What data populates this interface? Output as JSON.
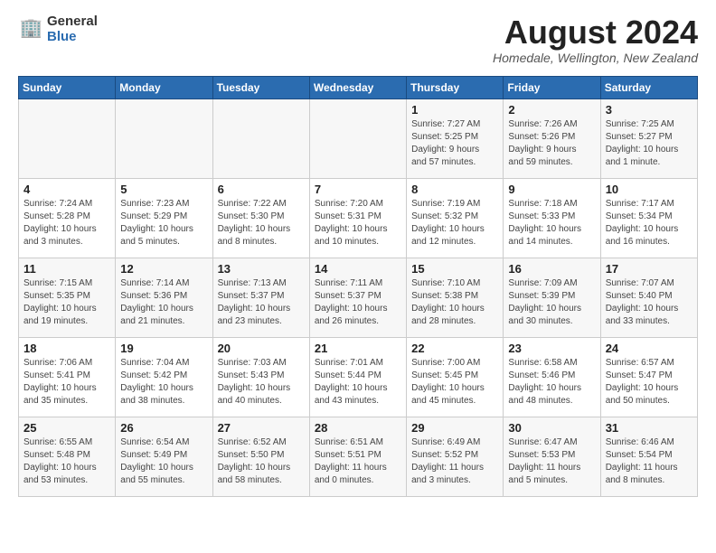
{
  "header": {
    "logo_general": "General",
    "logo_blue": "Blue",
    "month_title": "August 2024",
    "location": "Homedale, Wellington, New Zealand"
  },
  "calendar": {
    "days_of_week": [
      "Sunday",
      "Monday",
      "Tuesday",
      "Wednesday",
      "Thursday",
      "Friday",
      "Saturday"
    ],
    "weeks": [
      [
        {
          "day": "",
          "info": ""
        },
        {
          "day": "",
          "info": ""
        },
        {
          "day": "",
          "info": ""
        },
        {
          "day": "",
          "info": ""
        },
        {
          "day": "1",
          "info": "Sunrise: 7:27 AM\nSunset: 5:25 PM\nDaylight: 9 hours\nand 57 minutes."
        },
        {
          "day": "2",
          "info": "Sunrise: 7:26 AM\nSunset: 5:26 PM\nDaylight: 9 hours\nand 59 minutes."
        },
        {
          "day": "3",
          "info": "Sunrise: 7:25 AM\nSunset: 5:27 PM\nDaylight: 10 hours\nand 1 minute."
        }
      ],
      [
        {
          "day": "4",
          "info": "Sunrise: 7:24 AM\nSunset: 5:28 PM\nDaylight: 10 hours\nand 3 minutes."
        },
        {
          "day": "5",
          "info": "Sunrise: 7:23 AM\nSunset: 5:29 PM\nDaylight: 10 hours\nand 5 minutes."
        },
        {
          "day": "6",
          "info": "Sunrise: 7:22 AM\nSunset: 5:30 PM\nDaylight: 10 hours\nand 8 minutes."
        },
        {
          "day": "7",
          "info": "Sunrise: 7:20 AM\nSunset: 5:31 PM\nDaylight: 10 hours\nand 10 minutes."
        },
        {
          "day": "8",
          "info": "Sunrise: 7:19 AM\nSunset: 5:32 PM\nDaylight: 10 hours\nand 12 minutes."
        },
        {
          "day": "9",
          "info": "Sunrise: 7:18 AM\nSunset: 5:33 PM\nDaylight: 10 hours\nand 14 minutes."
        },
        {
          "day": "10",
          "info": "Sunrise: 7:17 AM\nSunset: 5:34 PM\nDaylight: 10 hours\nand 16 minutes."
        }
      ],
      [
        {
          "day": "11",
          "info": "Sunrise: 7:15 AM\nSunset: 5:35 PM\nDaylight: 10 hours\nand 19 minutes."
        },
        {
          "day": "12",
          "info": "Sunrise: 7:14 AM\nSunset: 5:36 PM\nDaylight: 10 hours\nand 21 minutes."
        },
        {
          "day": "13",
          "info": "Sunrise: 7:13 AM\nSunset: 5:37 PM\nDaylight: 10 hours\nand 23 minutes."
        },
        {
          "day": "14",
          "info": "Sunrise: 7:11 AM\nSunset: 5:37 PM\nDaylight: 10 hours\nand 26 minutes."
        },
        {
          "day": "15",
          "info": "Sunrise: 7:10 AM\nSunset: 5:38 PM\nDaylight: 10 hours\nand 28 minutes."
        },
        {
          "day": "16",
          "info": "Sunrise: 7:09 AM\nSunset: 5:39 PM\nDaylight: 10 hours\nand 30 minutes."
        },
        {
          "day": "17",
          "info": "Sunrise: 7:07 AM\nSunset: 5:40 PM\nDaylight: 10 hours\nand 33 minutes."
        }
      ],
      [
        {
          "day": "18",
          "info": "Sunrise: 7:06 AM\nSunset: 5:41 PM\nDaylight: 10 hours\nand 35 minutes."
        },
        {
          "day": "19",
          "info": "Sunrise: 7:04 AM\nSunset: 5:42 PM\nDaylight: 10 hours\nand 38 minutes."
        },
        {
          "day": "20",
          "info": "Sunrise: 7:03 AM\nSunset: 5:43 PM\nDaylight: 10 hours\nand 40 minutes."
        },
        {
          "day": "21",
          "info": "Sunrise: 7:01 AM\nSunset: 5:44 PM\nDaylight: 10 hours\nand 43 minutes."
        },
        {
          "day": "22",
          "info": "Sunrise: 7:00 AM\nSunset: 5:45 PM\nDaylight: 10 hours\nand 45 minutes."
        },
        {
          "day": "23",
          "info": "Sunrise: 6:58 AM\nSunset: 5:46 PM\nDaylight: 10 hours\nand 48 minutes."
        },
        {
          "day": "24",
          "info": "Sunrise: 6:57 AM\nSunset: 5:47 PM\nDaylight: 10 hours\nand 50 minutes."
        }
      ],
      [
        {
          "day": "25",
          "info": "Sunrise: 6:55 AM\nSunset: 5:48 PM\nDaylight: 10 hours\nand 53 minutes."
        },
        {
          "day": "26",
          "info": "Sunrise: 6:54 AM\nSunset: 5:49 PM\nDaylight: 10 hours\nand 55 minutes."
        },
        {
          "day": "27",
          "info": "Sunrise: 6:52 AM\nSunset: 5:50 PM\nDaylight: 10 hours\nand 58 minutes."
        },
        {
          "day": "28",
          "info": "Sunrise: 6:51 AM\nSunset: 5:51 PM\nDaylight: 11 hours\nand 0 minutes."
        },
        {
          "day": "29",
          "info": "Sunrise: 6:49 AM\nSunset: 5:52 PM\nDaylight: 11 hours\nand 3 minutes."
        },
        {
          "day": "30",
          "info": "Sunrise: 6:47 AM\nSunset: 5:53 PM\nDaylight: 11 hours\nand 5 minutes."
        },
        {
          "day": "31",
          "info": "Sunrise: 6:46 AM\nSunset: 5:54 PM\nDaylight: 11 hours\nand 8 minutes."
        }
      ]
    ]
  }
}
